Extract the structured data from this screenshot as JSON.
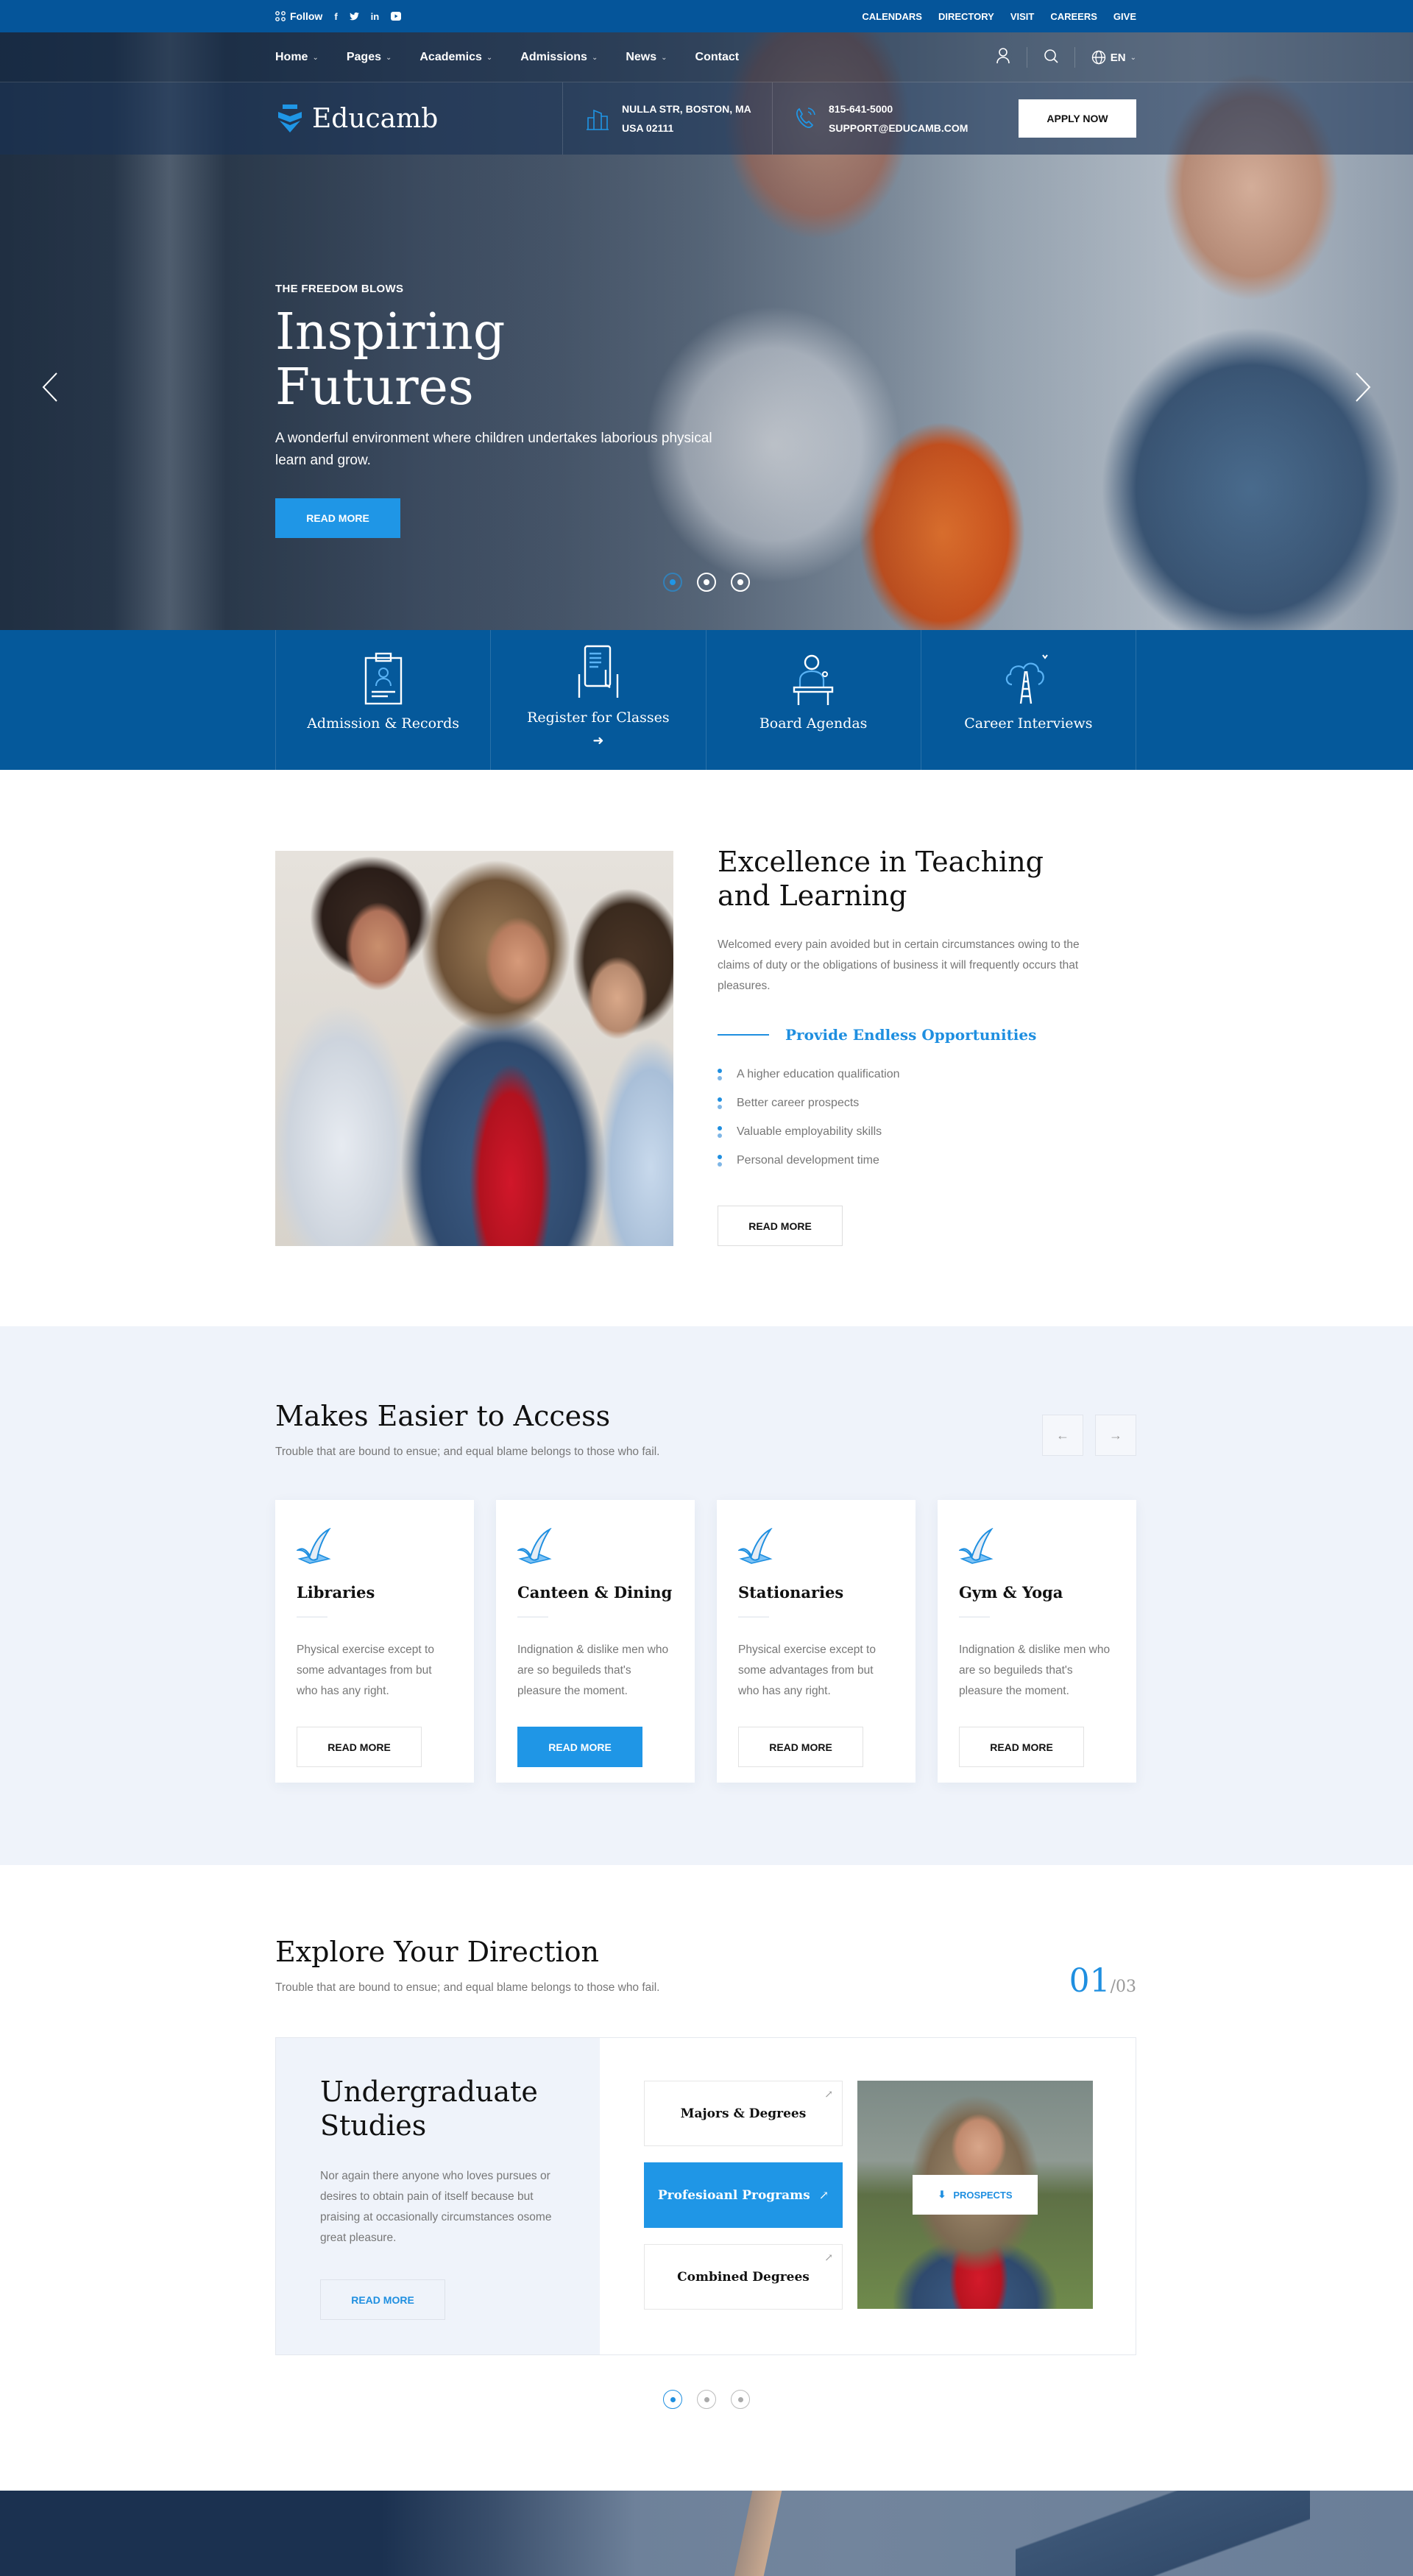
{
  "topbar": {
    "follow_label": "Follow",
    "social": [
      "facebook-icon",
      "twitter-icon",
      "linkedin-icon",
      "youtube-icon"
    ],
    "links": [
      "CALENDARS",
      "DIRECTORY",
      "VISIT",
      "CAREERS",
      "GIVE"
    ]
  },
  "nav": {
    "items": [
      {
        "label": "Home",
        "dropdown": true
      },
      {
        "label": "Pages",
        "dropdown": true
      },
      {
        "label": "Academics",
        "dropdown": true
      },
      {
        "label": "Admissions",
        "dropdown": true
      },
      {
        "label": "News",
        "dropdown": true
      },
      {
        "label": "Contact",
        "dropdown": false
      }
    ],
    "language": "EN"
  },
  "brand": {
    "name": "Educamb",
    "address_line1": "NULLA STR, BOSTON, MA",
    "address_line2": "USA 02111",
    "phone": "815-641-5000",
    "email": "SUPPORT@EDUCAMB.COM",
    "apply_label": "APPLY NOW"
  },
  "hero": {
    "eyebrow": "THE FREEDOM BLOWS",
    "title": "Inspiring Futures",
    "subtitle": "A wonderful environment where children undertakes laborious physical learn and grow.",
    "button": "READ MORE",
    "slide_count": 3,
    "active_slide": 1
  },
  "features": [
    {
      "label": "Admission & Records",
      "icon": "clipboard-id-icon",
      "arrow": false
    },
    {
      "label": "Register for Classes",
      "icon": "tablet-touch-icon",
      "arrow": true
    },
    {
      "label": "Board Agendas",
      "icon": "speaker-podium-icon",
      "arrow": false
    },
    {
      "label": "Career Interviews",
      "icon": "cloud-ladder-icon",
      "arrow": false
    }
  ],
  "about": {
    "title": "Excellence in Teaching and Learning",
    "paragraph": "Welcomed every pain avoided but in certain circumstances owing to the claims of duty or the obligations of business it will frequently occurs that pleasures.",
    "subheading": "Provide Endless Opportunities",
    "bullets": [
      "A higher education qualification",
      "Better career prospects",
      "Valuable employability skills",
      "Personal development time"
    ],
    "button": "READ MORE"
  },
  "access": {
    "title": "Makes Easier to Access",
    "subtitle": "Trouble that are bound to ensue; and equal blame belongs to those who fail.",
    "cards": [
      {
        "title": "Libraries",
        "text": "Physical exercise except to some advantages from but who has any right.",
        "button": "READ MORE",
        "active": false
      },
      {
        "title": "Canteen & Dining",
        "text": "Indignation & dislike men who are so beguileds that's pleasure the moment.",
        "button": "READ MORE",
        "active": true
      },
      {
        "title": "Stationaries",
        "text": "Physical exercise except to some advantages from but who has any right.",
        "button": "READ MORE",
        "active": false
      },
      {
        "title": "Gym & Yoga",
        "text": "Indignation & dislike men who are so beguileds that's pleasure the moment.",
        "button": "READ MORE",
        "active": false
      }
    ]
  },
  "explore": {
    "title": "Explore Your Direction",
    "subtitle": "Trouble that are bound to ensue; and equal blame belongs to those who fail.",
    "counter_current": "01",
    "counter_total": "/03",
    "panel_title": "Undergraduate Studies",
    "panel_text": "Nor again there anyone who loves pursues or desires to obtain pain of itself because but praising at occasionally circumstances osome great pleasure.",
    "panel_button": "READ MORE",
    "options": [
      {
        "label": "Majors & Degrees",
        "active": false
      },
      {
        "label": "Profesioanl Programs",
        "active": true
      },
      {
        "label": "Combined Degrees",
        "active": false
      }
    ],
    "prospects_label": "PROSPECTS",
    "slide_count": 3,
    "active_slide": 1
  },
  "colors": {
    "primary_dark": "#05599b",
    "accent": "#1f96e6",
    "light_bg": "#eff3fa",
    "text_muted": "#777777"
  }
}
